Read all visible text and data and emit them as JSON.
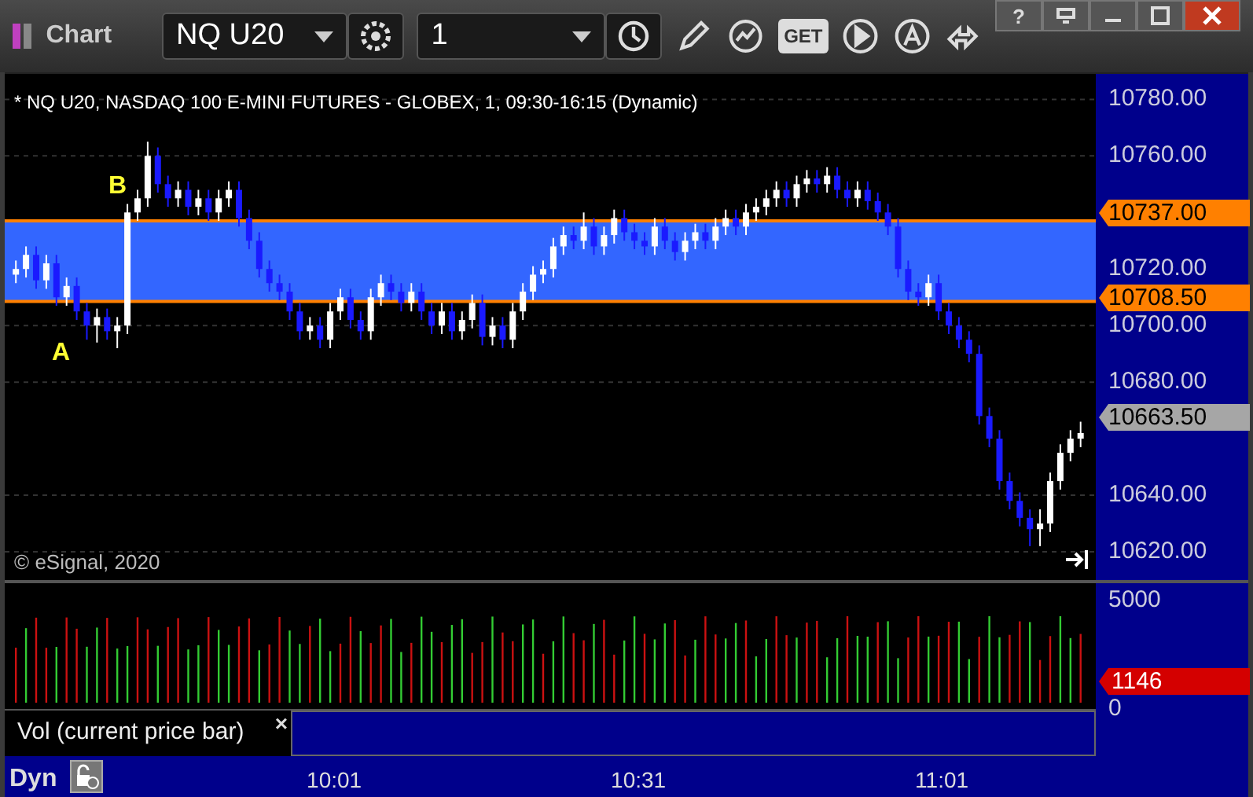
{
  "window": {
    "title": "Chart",
    "help": "?"
  },
  "toolbar": {
    "symbol": "NQ U20",
    "interval": "1",
    "get_label": "GET"
  },
  "chart": {
    "header": "* NQ U20, NASDAQ 100 E-MINI FUTURES - GLOBEX, 1, 09:30-16:15 (Dynamic)",
    "copyright": "© eSignal, 2020",
    "annotations": [
      {
        "text": "B"
      },
      {
        "text": "A"
      }
    ],
    "markers": [
      {
        "text": "10737.00",
        "color": "#ff8000"
      },
      {
        "text": "10708.50",
        "color": "#ff8000"
      },
      {
        "text": "10663.50",
        "color": "#a6a6a6"
      }
    ],
    "chart_data": {
      "type": "candlestick",
      "ylim": [
        10610,
        10789
      ],
      "grid": true,
      "yticks": [
        {
          "value": 10780,
          "label": "10780.00"
        },
        {
          "value": 10760,
          "label": "10760.00"
        },
        {
          "value": 10720,
          "label": "10720.00"
        },
        {
          "value": 10700,
          "label": "10700.00"
        },
        {
          "value": 10680,
          "label": "10680.00"
        },
        {
          "value": 10640,
          "label": "10640.00"
        },
        {
          "value": 10620,
          "label": "10620.00"
        }
      ],
      "bands": [
        {
          "axis": "y",
          "from": 10708.5,
          "to": 10737,
          "color": "#3366ff"
        }
      ],
      "ref_lines": [
        {
          "axis": "y",
          "value": 10737,
          "color": "#ff8000"
        },
        {
          "axis": "y",
          "value": 10708.5,
          "color": "#ff8000"
        }
      ],
      "categories": [
        null,
        null,
        null,
        null,
        null,
        null,
        null,
        null,
        null,
        null,
        null,
        null,
        null,
        null,
        null,
        null,
        null,
        null,
        null,
        null,
        null,
        null,
        null,
        null,
        null,
        null,
        null,
        null,
        null,
        null,
        null,
        null,
        null,
        null,
        null,
        null,
        null,
        null,
        null,
        null,
        null,
        null,
        null,
        null,
        null,
        null,
        null,
        null,
        null,
        null,
        null,
        null,
        null,
        null,
        null,
        null,
        null,
        null,
        null,
        null,
        null,
        null,
        null,
        null,
        null,
        null,
        null,
        null,
        null,
        null,
        null,
        null,
        null,
        null,
        null,
        null,
        null,
        null,
        null,
        null,
        null,
        null,
        null,
        null,
        null,
        null,
        null,
        null,
        null,
        null,
        null,
        null,
        null,
        null,
        null,
        null,
        null,
        null,
        null,
        null,
        null,
        null,
        null,
        null,
        null,
        null
      ],
      "ohlc": [
        [
          10718,
          10723,
          10715,
          10720
        ],
        [
          10720,
          10728,
          10717,
          10725
        ],
        [
          10725,
          10728,
          10713,
          10716
        ],
        [
          10716,
          10725,
          10713,
          10722
        ],
        [
          10722,
          10725,
          10707,
          10710
        ],
        [
          10710,
          10717,
          10707,
          10714
        ],
        [
          10714,
          10717,
          10702,
          10705
        ],
        [
          10705,
          10708,
          10695,
          10700
        ],
        [
          10700,
          10706,
          10694,
          10703
        ],
        [
          10703,
          10706,
          10695,
          10698
        ],
        [
          10698,
          10703,
          10692,
          10700
        ],
        [
          10700,
          10743,
          10697,
          10740
        ],
        [
          10740,
          10748,
          10737,
          10745
        ],
        [
          10745,
          10765,
          10742,
          10760
        ],
        [
          10760,
          10763,
          10747,
          10750
        ],
        [
          10750,
          10753,
          10742,
          10745
        ],
        [
          10745,
          10751,
          10742,
          10748
        ],
        [
          10748,
          10751,
          10739,
          10742
        ],
        [
          10742,
          10748,
          10739,
          10745
        ],
        [
          10745,
          10748,
          10737,
          10740
        ],
        [
          10740,
          10748,
          10737,
          10745
        ],
        [
          10745,
          10751,
          10742,
          10748
        ],
        [
          10748,
          10751,
          10735,
          10738
        ],
        [
          10738,
          10741,
          10727,
          10730
        ],
        [
          10730,
          10733,
          10717,
          10720
        ],
        [
          10720,
          10723,
          10712,
          10715
        ],
        [
          10715,
          10718,
          10709,
          10712
        ],
        [
          10712,
          10715,
          10702,
          10705
        ],
        [
          10705,
          10708,
          10695,
          10698
        ],
        [
          10698,
          10703,
          10695,
          10700
        ],
        [
          10700,
          10703,
          10692,
          10695
        ],
        [
          10695,
          10708,
          10692,
          10705
        ],
        [
          10705,
          10713,
          10702,
          10710
        ],
        [
          10710,
          10713,
          10699,
          10702
        ],
        [
          10702,
          10705,
          10695,
          10698
        ],
        [
          10698,
          10713,
          10695,
          10710
        ],
        [
          10710,
          10718,
          10707,
          10715
        ],
        [
          10715,
          10718,
          10709,
          10712
        ],
        [
          10712,
          10715,
          10705,
          10708
        ],
        [
          10708,
          10715,
          10705,
          10712
        ],
        [
          10712,
          10715,
          10702,
          10705
        ],
        [
          10705,
          10708,
          10697,
          10700
        ],
        [
          10700,
          10708,
          10697,
          10705
        ],
        [
          10705,
          10708,
          10695,
          10698
        ],
        [
          10698,
          10705,
          10695,
          10702
        ],
        [
          10702,
          10711,
          10699,
          10708
        ],
        [
          10708,
          10711,
          10693,
          10696
        ],
        [
          10696,
          10703,
          10693,
          10700
        ],
        [
          10700,
          10703,
          10692,
          10695
        ],
        [
          10695,
          10708,
          10692,
          10705
        ],
        [
          10705,
          10715,
          10702,
          10712
        ],
        [
          10712,
          10721,
          10709,
          10718
        ],
        [
          10718,
          10723,
          10715,
          10720
        ],
        [
          10720,
          10731,
          10717,
          10728
        ],
        [
          10728,
          10735,
          10725,
          10732
        ],
        [
          10732,
          10735,
          10727,
          10730
        ],
        [
          10730,
          10740,
          10727,
          10735
        ],
        [
          10735,
          10738,
          10725,
          10728
        ],
        [
          10728,
          10735,
          10725,
          10732
        ],
        [
          10732,
          10741,
          10729,
          10738
        ],
        [
          10738,
          10741,
          10730,
          10733
        ],
        [
          10733,
          10736,
          10727,
          10730
        ],
        [
          10730,
          10733,
          10725,
          10728
        ],
        [
          10728,
          10738,
          10725,
          10735
        ],
        [
          10735,
          10738,
          10727,
          10730
        ],
        [
          10730,
          10733,
          10723,
          10726
        ],
        [
          10726,
          10733,
          10723,
          10730
        ],
        [
          10730,
          10736,
          10727,
          10733
        ],
        [
          10733,
          10736,
          10727,
          10730
        ],
        [
          10730,
          10738,
          10727,
          10735
        ],
        [
          10735,
          10741,
          10732,
          10738
        ],
        [
          10738,
          10741,
          10732,
          10735
        ],
        [
          10735,
          10743,
          10732,
          10740
        ],
        [
          10740,
          10745,
          10737,
          10742
        ],
        [
          10742,
          10748,
          10739,
          10745
        ],
        [
          10745,
          10751,
          10742,
          10748
        ],
        [
          10748,
          10751,
          10742,
          10745
        ],
        [
          10745,
          10753,
          10742,
          10750
        ],
        [
          10750,
          10755,
          10747,
          10752
        ],
        [
          10752,
          10755,
          10747,
          10750
        ],
        [
          10750,
          10756,
          10747,
          10753
        ],
        [
          10753,
          10756,
          10745,
          10748
        ],
        [
          10748,
          10751,
          10742,
          10745
        ],
        [
          10745,
          10751,
          10742,
          10748
        ],
        [
          10748,
          10751,
          10741,
          10744
        ],
        [
          10744,
          10747,
          10737,
          10740
        ],
        [
          10740,
          10743,
          10732,
          10735
        ],
        [
          10735,
          10738,
          10717,
          10720
        ],
        [
          10720,
          10723,
          10709,
          10712
        ],
        [
          10712,
          10715,
          10707,
          10710
        ],
        [
          10710,
          10718,
          10707,
          10715
        ],
        [
          10715,
          10718,
          10702,
          10705
        ],
        [
          10705,
          10708,
          10697,
          10700
        ],
        [
          10700,
          10703,
          10692,
          10695
        ],
        [
          10695,
          10698,
          10687,
          10690
        ],
        [
          10690,
          10693,
          10665,
          10668
        ],
        [
          10668,
          10671,
          10657,
          10660
        ],
        [
          10660,
          10663,
          10642,
          10645
        ],
        [
          10645,
          10648,
          10635,
          10638
        ],
        [
          10638,
          10641,
          10629,
          10632
        ],
        [
          10632,
          10635,
          10622,
          10628
        ],
        [
          10628,
          10635,
          10622,
          10630
        ],
        [
          10630,
          10648,
          10627,
          10645
        ],
        [
          10645,
          10658,
          10642,
          10655
        ],
        [
          10655,
          10663,
          10652,
          10660
        ],
        [
          10660,
          10666,
          10657,
          10662
        ]
      ]
    }
  },
  "volume": {
    "label": "Vol (current price bar)",
    "close": "×",
    "axis": [
      "5000",
      "0"
    ],
    "marker": {
      "text": "1146",
      "color": "#d40000"
    }
  },
  "time_axis": [
    "10:01",
    "10:31",
    "11:01"
  ],
  "status": {
    "mode": "Dyn"
  }
}
